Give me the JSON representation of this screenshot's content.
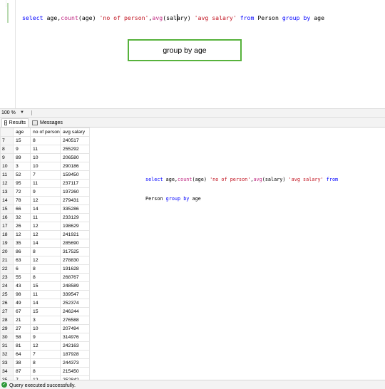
{
  "editor": {
    "query_tokens": [
      {
        "t": "select",
        "c": "kw"
      },
      {
        "t": " age,",
        "c": ""
      },
      {
        "t": "count",
        "c": "fn"
      },
      {
        "t": "(age) ",
        "c": ""
      },
      {
        "t": "'no of person'",
        "c": "str"
      },
      {
        "t": ",",
        "c": ""
      },
      {
        "t": "avg",
        "c": "fn"
      },
      {
        "t": "(sal",
        "c": ""
      },
      {
        "t": "|",
        "c": "caret"
      },
      {
        "t": "ary) ",
        "c": ""
      },
      {
        "t": "'avg salary'",
        "c": "str"
      },
      {
        "t": " ",
        "c": ""
      },
      {
        "t": "from",
        "c": "kw"
      },
      {
        "t": " Person ",
        "c": ""
      },
      {
        "t": "group",
        "c": "kw"
      },
      {
        "t": " ",
        "c": ""
      },
      {
        "t": "by",
        "c": "kw"
      },
      {
        "t": " age",
        "c": ""
      }
    ],
    "annotation_label": "group by age"
  },
  "zoom": {
    "level": "100 %"
  },
  "tabs": {
    "results": "Results",
    "messages": "Messages"
  },
  "grid": {
    "columns": [
      "age",
      "no of person",
      "avg salary"
    ],
    "rows": [
      [
        "7",
        "15",
        "8",
        "240517"
      ],
      [
        "8",
        "9",
        "11",
        "255292"
      ],
      [
        "9",
        "89",
        "10",
        "206580"
      ],
      [
        "10",
        "3",
        "10",
        "290186"
      ],
      [
        "11",
        "52",
        "7",
        "159450"
      ],
      [
        "12",
        "95",
        "11",
        "237117"
      ],
      [
        "13",
        "72",
        "9",
        "197260"
      ],
      [
        "14",
        "78",
        "12",
        "279431"
      ],
      [
        "15",
        "66",
        "14",
        "335286"
      ],
      [
        "16",
        "32",
        "11",
        "233129"
      ],
      [
        "17",
        "26",
        "12",
        "198629"
      ],
      [
        "18",
        "12",
        "12",
        "241921"
      ],
      [
        "19",
        "35",
        "14",
        "285690"
      ],
      [
        "20",
        "86",
        "8",
        "317525"
      ],
      [
        "21",
        "63",
        "12",
        "278830"
      ],
      [
        "22",
        "6",
        "8",
        "191628"
      ],
      [
        "23",
        "55",
        "8",
        "268767"
      ],
      [
        "24",
        "43",
        "15",
        "248589"
      ],
      [
        "25",
        "98",
        "11",
        "339547"
      ],
      [
        "26",
        "49",
        "14",
        "252374"
      ],
      [
        "27",
        "67",
        "15",
        "246244"
      ],
      [
        "28",
        "21",
        "3",
        "276588"
      ],
      [
        "29",
        "27",
        "10",
        "207494"
      ],
      [
        "30",
        "58",
        "9",
        "314976"
      ],
      [
        "31",
        "81",
        "12",
        "242163"
      ],
      [
        "32",
        "64",
        "7",
        "187928"
      ],
      [
        "33",
        "38",
        "8",
        "244373"
      ],
      [
        "34",
        "87",
        "8",
        "215450"
      ],
      [
        "35",
        "7",
        "12",
        "252842"
      ]
    ]
  },
  "query_copy": {
    "line1_tokens": [
      {
        "t": "select",
        "c": "kw"
      },
      {
        "t": " age,",
        "c": ""
      },
      {
        "t": "count",
        "c": "fn"
      },
      {
        "t": "(age) ",
        "c": ""
      },
      {
        "t": "'no of person'",
        "c": "str"
      },
      {
        "t": ",",
        "c": ""
      },
      {
        "t": "avg",
        "c": "fn"
      },
      {
        "t": "(salary) ",
        "c": ""
      },
      {
        "t": "'avg salary'",
        "c": "str"
      },
      {
        "t": " ",
        "c": ""
      },
      {
        "t": "from",
        "c": "kw"
      }
    ],
    "line2_tokens": [
      {
        "t": "Person ",
        "c": ""
      },
      {
        "t": "group",
        "c": "kw"
      },
      {
        "t": " ",
        "c": ""
      },
      {
        "t": "by",
        "c": "kw"
      },
      {
        "t": " age",
        "c": ""
      }
    ]
  },
  "status": {
    "message": "Query executed successfully.",
    "icon": "check-circle-icon"
  },
  "colors": {
    "keyword": "#0000ff",
    "function": "#c12b84",
    "string": "#c1121f",
    "annotation_border": "#57b23c",
    "success": "#2f9a3a"
  }
}
